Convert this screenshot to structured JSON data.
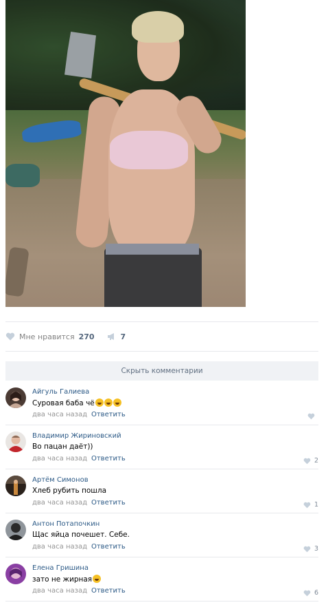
{
  "post": {
    "photo_alt": "",
    "likes": {
      "label": "Мне нравится",
      "count": "270"
    },
    "shares": {
      "count": "7"
    },
    "hide_comments_label": "Скрыть комментарии"
  },
  "comments": [
    {
      "author": "Айгуль Галиева",
      "text": "Суровая баба чё",
      "emoji": "😂😂😂",
      "date": "два часа назад",
      "reply": "Ответить",
      "likes": ""
    },
    {
      "author": "Владимир Жириновский",
      "text": "Во пацан даёт))",
      "emoji": "",
      "date": "два часа назад",
      "reply": "Ответить",
      "likes": "2"
    },
    {
      "author": "Артём Симонов",
      "text": "Хлеб рубить пошла",
      "emoji": "",
      "date": "два часа назад",
      "reply": "Ответить",
      "likes": "1"
    },
    {
      "author": "Антон Потапочкин",
      "text": "Щас яйца почешет. Себе.",
      "emoji": "",
      "date": "два часа назад",
      "reply": "Ответить",
      "likes": "3"
    },
    {
      "author": "Елена Гришина",
      "text": "зато не жирная",
      "emoji": "😀",
      "date": "два часа назад",
      "reply": "Ответить",
      "likes": "6"
    }
  ],
  "icons": {
    "like": "heart-icon",
    "share": "megaphone-icon",
    "comment_like": "heart-icon"
  },
  "colors": {
    "link": "#2a5885",
    "muted": "#939393",
    "like_icon": "#c5d0db",
    "hide_bg": "#f0f2f5"
  }
}
